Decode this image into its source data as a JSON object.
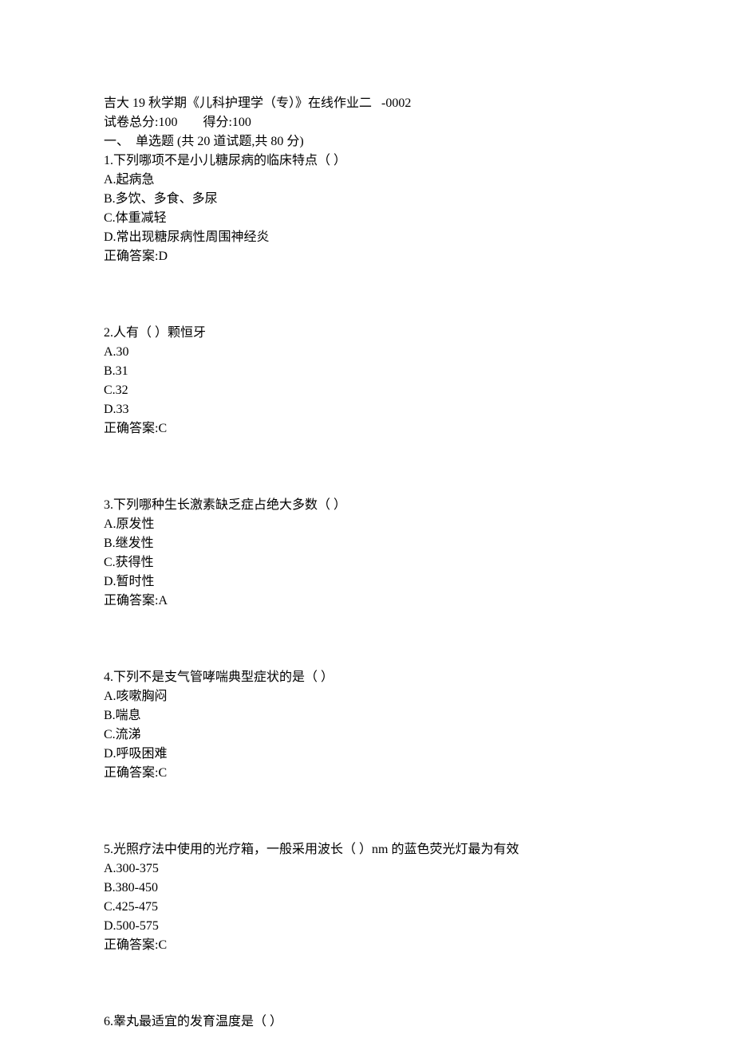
{
  "header": {
    "title": "吉大 19 秋学期《儿科护理学（专）》在线作业二   -0002",
    "score_line": "试卷总分:100        得分:100",
    "section_title": "一、  单选题 (共 20 道试题,共 80 分)"
  },
  "questions": [
    {
      "num": "1",
      "stem": "下列哪项不是小儿糖尿病的临床特点（ ）",
      "options": [
        {
          "label": "A",
          "text": "起病急"
        },
        {
          "label": "B",
          "text": "多饮、多食、多尿"
        },
        {
          "label": "C",
          "text": "体重减轻"
        },
        {
          "label": "D",
          "text": "常出现糖尿病性周围神经炎"
        }
      ],
      "answer": "D"
    },
    {
      "num": "2",
      "stem": "人有（ ）颗恒牙",
      "options": [
        {
          "label": "A",
          "text": "30"
        },
        {
          "label": "B",
          "text": "31"
        },
        {
          "label": "C",
          "text": "32"
        },
        {
          "label": "D",
          "text": "33"
        }
      ],
      "answer": "C"
    },
    {
      "num": "3",
      "stem": "下列哪种生长激素缺乏症占绝大多数（ ）",
      "options": [
        {
          "label": "A",
          "text": "原发性"
        },
        {
          "label": "B",
          "text": "继发性"
        },
        {
          "label": "C",
          "text": "获得性"
        },
        {
          "label": "D",
          "text": "暂时性"
        }
      ],
      "answer": "A"
    },
    {
      "num": "4",
      "stem": "下列不是支气管哮喘典型症状的是（ ）",
      "options": [
        {
          "label": "A",
          "text": "咳嗽胸闷"
        },
        {
          "label": "B",
          "text": "喘息"
        },
        {
          "label": "C",
          "text": "流涕"
        },
        {
          "label": "D",
          "text": "呼吸困难"
        }
      ],
      "answer": "C"
    },
    {
      "num": "5",
      "stem": "光照疗法中使用的光疗箱，一般采用波长（ ）nm 的蓝色荧光灯最为有效",
      "options": [
        {
          "label": "A",
          "text": "300-375"
        },
        {
          "label": "B",
          "text": "380-450"
        },
        {
          "label": "C",
          "text": "425-475"
        },
        {
          "label": "D",
          "text": "500-575"
        }
      ],
      "answer": "C"
    },
    {
      "num": "6",
      "stem": "睾丸最适宜的发育温度是（ ）",
      "options": [],
      "answer": null
    }
  ],
  "labels": {
    "answer_prefix": "正确答案:"
  }
}
